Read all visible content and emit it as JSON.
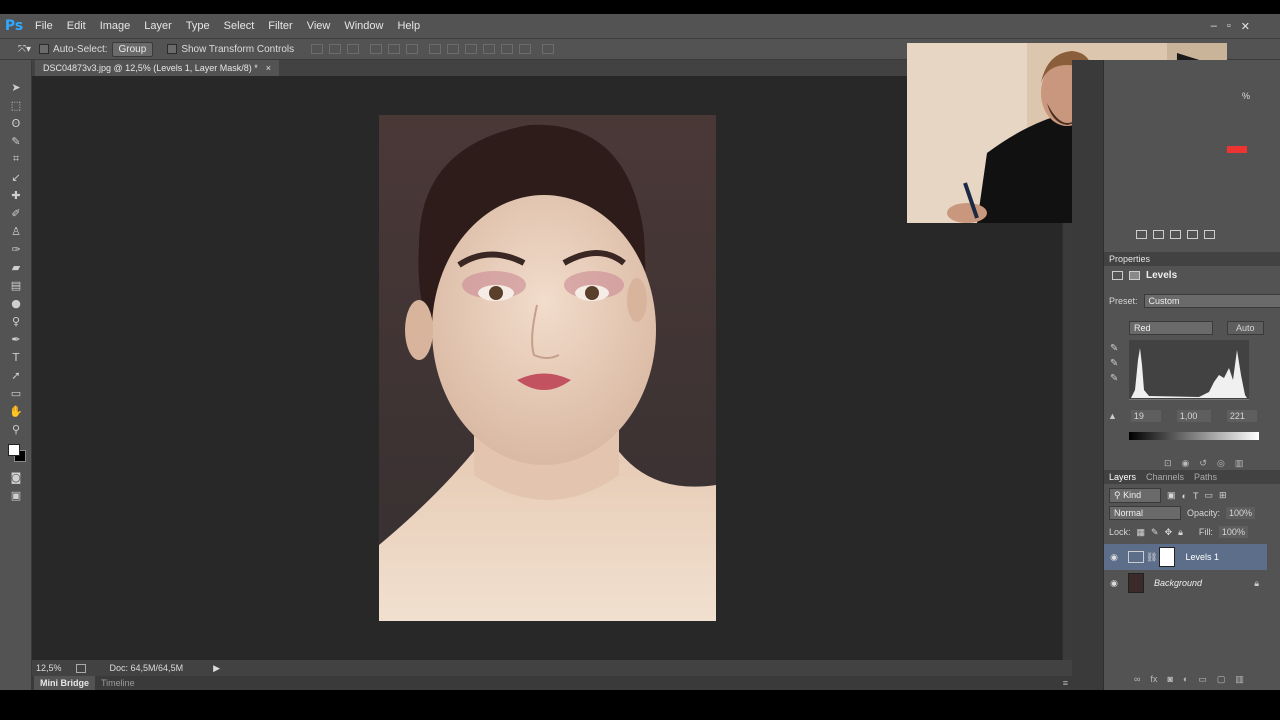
{
  "app": {
    "logo": "Ps"
  },
  "menu": [
    "File",
    "Edit",
    "Image",
    "Layer",
    "Type",
    "Select",
    "Filter",
    "View",
    "Window",
    "Help"
  ],
  "options": {
    "auto_select_label": "Auto-Select:",
    "auto_select_value": "Group",
    "show_transform_label": "Show Transform Controls"
  },
  "document": {
    "tab_title": "DSC04873v3.jpg @ 12,5% (Levels 1, Layer Mask/8) *",
    "close": "×"
  },
  "status": {
    "zoom": "12,5%",
    "doc": "Doc: 64,5M/64,5M"
  },
  "bottom_tabs": [
    "Mini Bridge",
    "Timeline"
  ],
  "properties": {
    "header": "Properties",
    "title": "Levels",
    "preset_label": "Preset:",
    "preset_value": "Custom",
    "channel_value": "Red",
    "auto_label": "Auto",
    "input_black": "19",
    "input_gamma": "1,00",
    "input_white": "221"
  },
  "layers_panel": {
    "tabs": [
      "Layers",
      "Channels",
      "Paths"
    ],
    "kind_label": "Kind",
    "blend_mode": "Normal",
    "opacity_label": "Opacity:",
    "opacity_value": "100%",
    "lock_label": "Lock:",
    "fill_label": "Fill:",
    "fill_value": "100%",
    "layers": [
      {
        "name": "Levels 1",
        "selected": true
      },
      {
        "name": "Background",
        "selected": false
      }
    ]
  },
  "misc": {
    "percent": "%"
  },
  "colors": {
    "panel_bg": "#535353",
    "canvas_bg": "#282828",
    "selected_layer": "#5d6e8a",
    "ps_blue": "#31a8ff"
  }
}
